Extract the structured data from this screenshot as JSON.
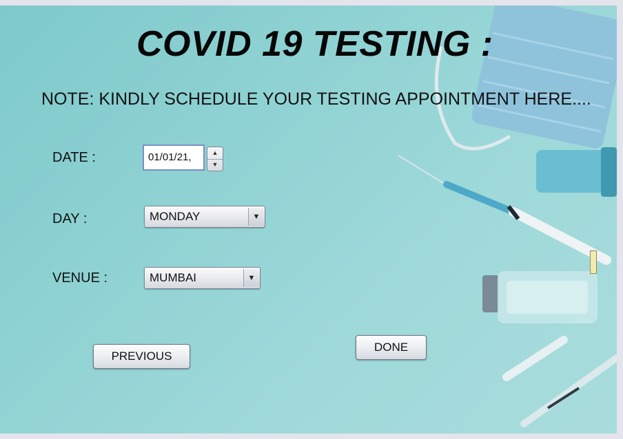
{
  "title": "COVID 19 TESTING :",
  "note": "NOTE: KINDLY SCHEDULE YOUR TESTING APPOINTMENT HERE....",
  "form": {
    "date_label": "DATE :",
    "date_value": "01/01/21,",
    "day_label": "DAY :",
    "day_value": "MONDAY",
    "venue_label": "VENUE :",
    "venue_value": "MUMBAI"
  },
  "buttons": {
    "previous": "PREVIOUS",
    "done": "DONE"
  },
  "icons": {
    "spinner_up": "▲",
    "spinner_down": "▼",
    "dropdown": "▼"
  },
  "colors": {
    "background": "#8fd2d3",
    "title": "#070707",
    "field_border": "#7a8fc4"
  }
}
